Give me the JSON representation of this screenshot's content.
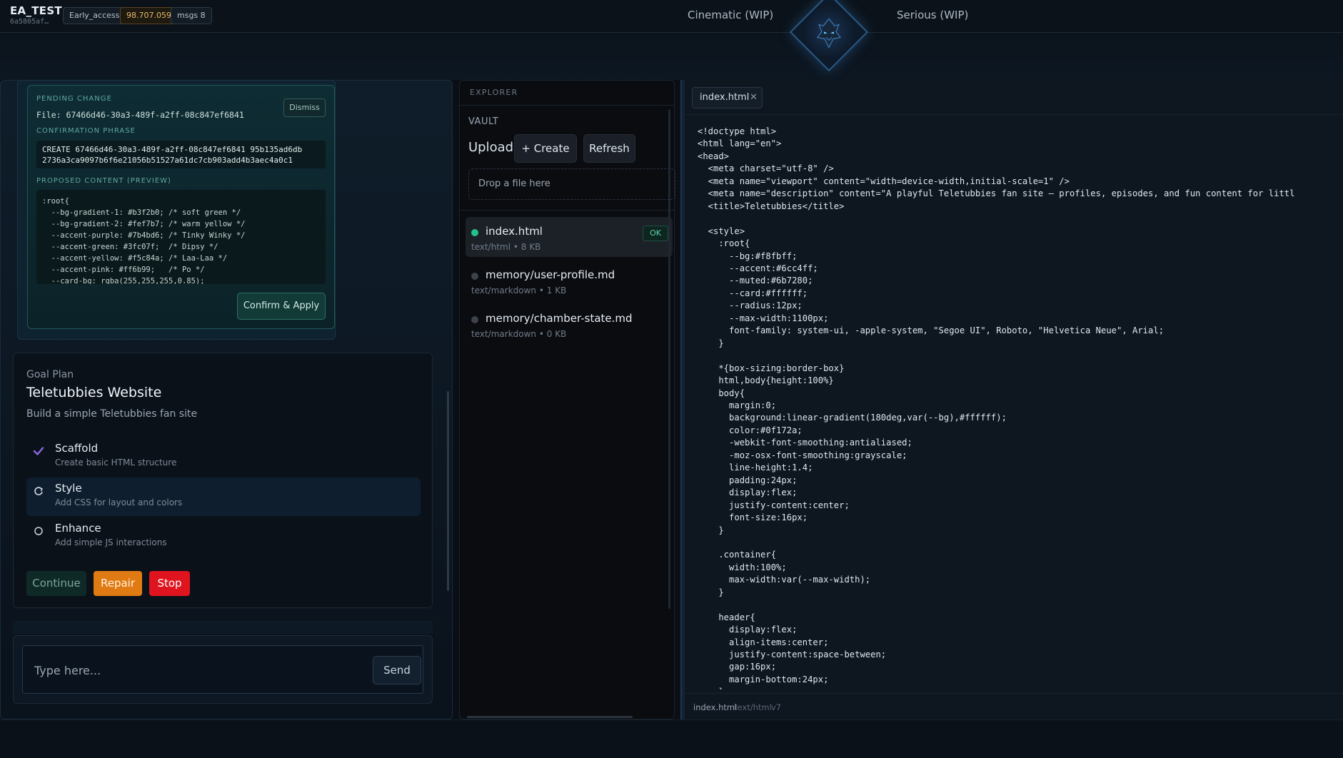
{
  "topbar": {
    "brand": "EA_TEST",
    "brand_id": "6a5805af…",
    "pills": [
      "Early_access",
      "98.707.059",
      "msgs 8"
    ],
    "modes": [
      "Cinematic (WIP)",
      "Serious (WIP)"
    ]
  },
  "pending": {
    "label": "PENDING CHANGE",
    "file": "File: 67466d46-30a3-489f-a2ff-08c847ef6841",
    "dismiss": "Dismiss",
    "phrase_label": "CONFIRMATION PHRASE",
    "phrase": "CREATE 67466d46-30a3-489f-a2ff-08c847ef6841 95b135ad6db\n2736a3ca9097b6f6e21056b51527a61dc7cb903add4b3aec4a0c1",
    "preview_label": "PROPOSED CONTENT (PREVIEW)",
    "preview": ":root{\n  --bg-gradient-1: #b3f2b0; /* soft green */\n  --bg-gradient-2: #fef7b7; /* warm yellow */\n  --accent-purple: #7b4bd6; /* Tinky Winky */\n  --accent-green: #3fc07f;  /* Dipsy */\n  --accent-yellow: #f5c84a; /* Laa-Laa */\n  --accent-pink: #ff6b99;   /* Po */\n  --card-bg: rgba(255,255,255,0.85);",
    "confirm": "Confirm & Apply"
  },
  "goal": {
    "kicker": "Goal Plan",
    "title": "Teletubbies Website",
    "description": "Build a simple Teletubbies fan site",
    "steps": [
      {
        "title": "Scaffold",
        "sub": "Create basic HTML structure",
        "state": "done"
      },
      {
        "title": "Style",
        "sub": "Add CSS for layout and colors",
        "state": "active"
      },
      {
        "title": "Enhance",
        "sub": "Add simple JS interactions",
        "state": "todo"
      }
    ],
    "buttons": {
      "continue": "Continue",
      "repair": "Repair",
      "stop": "Stop"
    }
  },
  "composer": {
    "placeholder": "Type here...",
    "send": "Send"
  },
  "explorer": {
    "header": "EXPLORER",
    "vault": "VAULT",
    "upload": "Upload",
    "create": "+ Create",
    "refresh": "Refresh",
    "dropzone": "Drop a file here",
    "files": [
      {
        "name": "index.html",
        "meta": "text/html • 8 KB",
        "badge": "OK",
        "status": "ok"
      },
      {
        "name": "memory/user-profile.md",
        "meta": "text/markdown • 1 KB",
        "status": "idle"
      },
      {
        "name": "memory/chamber-state.md",
        "meta": "text/markdown • 0 KB",
        "status": "idle"
      }
    ]
  },
  "editor": {
    "tab": "index.html",
    "code": "<!doctype html>\n<html lang=\"en\">\n<head>\n  <meta charset=\"utf-8\" />\n  <meta name=\"viewport\" content=\"width=device-width,initial-scale=1\" />\n  <meta name=\"description\" content=\"A playful Teletubbies fan site — profiles, episodes, and fun content for littl\n  <title>Teletubbies</title>\n\n  <style>\n    :root{\n      --bg:#f8fbff;\n      --accent:#6cc4ff;\n      --muted:#6b7280;\n      --card:#ffffff;\n      --radius:12px;\n      --max-width:1100px;\n      font-family: system-ui, -apple-system, \"Segoe UI\", Roboto, \"Helvetica Neue\", Arial;\n    }\n\n    *{box-sizing:border-box}\n    html,body{height:100%}\n    body{\n      margin:0;\n      background:linear-gradient(180deg,var(--bg),#ffffff);\n      color:#0f172a;\n      -webkit-font-smoothing:antialiased;\n      -moz-osx-font-smoothing:grayscale;\n      line-height:1.4;\n      padding:24px;\n      display:flex;\n      justify-content:center;\n      font-size:16px;\n    }\n\n    .container{\n      width:100%;\n      max-width:var(--max-width);\n    }\n\n    header{\n      display:flex;\n      align-items:center;\n      justify-content:space-between;\n      gap:16px;\n      margin-bottom:24px;\n    }",
    "status": {
      "file": "index.html",
      "type": "text/html",
      "version": "v7"
    }
  },
  "colors": {
    "accent_teal": "#1f5a56",
    "ok_green": "#22c38a",
    "repair": "#e07a12",
    "stop": "#e0141e"
  },
  "icons": {
    "done": "check-icon",
    "active": "spinner-icon",
    "todo": "circle-icon",
    "close": "close-icon"
  }
}
